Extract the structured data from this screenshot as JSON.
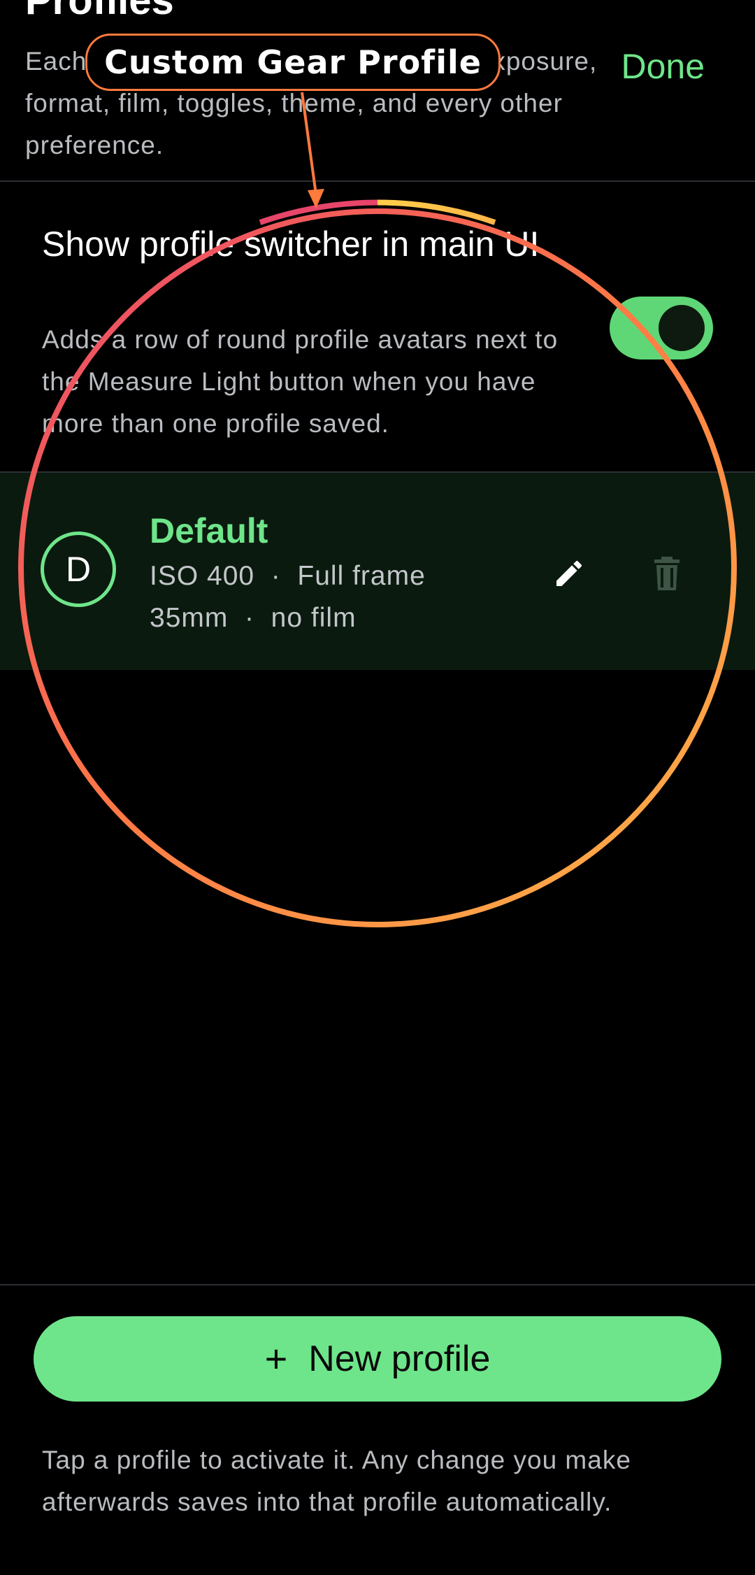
{
  "header": {
    "title": "Profiles",
    "description": "Each profile saves your entire setup: exposure, format, film, toggles, theme, and every other preference.",
    "done_label": "Done"
  },
  "switcher_setting": {
    "title": "Show profile switcher in main UI",
    "description": "Adds a row of round profile avatars next to the Measure Light button when you have more than one profile saved.",
    "enabled": true
  },
  "profiles": [
    {
      "avatar_letter": "D",
      "name": "Default",
      "meta_line1": "ISO 400  ·  Full frame",
      "meta_line2": "35mm  ·  no film",
      "active": true
    }
  ],
  "actions": {
    "new_profile_label": "New profile",
    "new_profile_icon": "plus-icon"
  },
  "footer": {
    "note": "Tap a profile to activate it. Any change you make afterwards saves into that profile automatically."
  },
  "overlay": {
    "callout_label": "Custom Gear Profile"
  },
  "colors": {
    "accent": "#6ee58a",
    "background": "#000000",
    "profile_row_bg": "#0b1a0f",
    "secondary_text": "#b9bcc0",
    "ring_start": "#e8456b",
    "ring_end": "#ffb648"
  }
}
